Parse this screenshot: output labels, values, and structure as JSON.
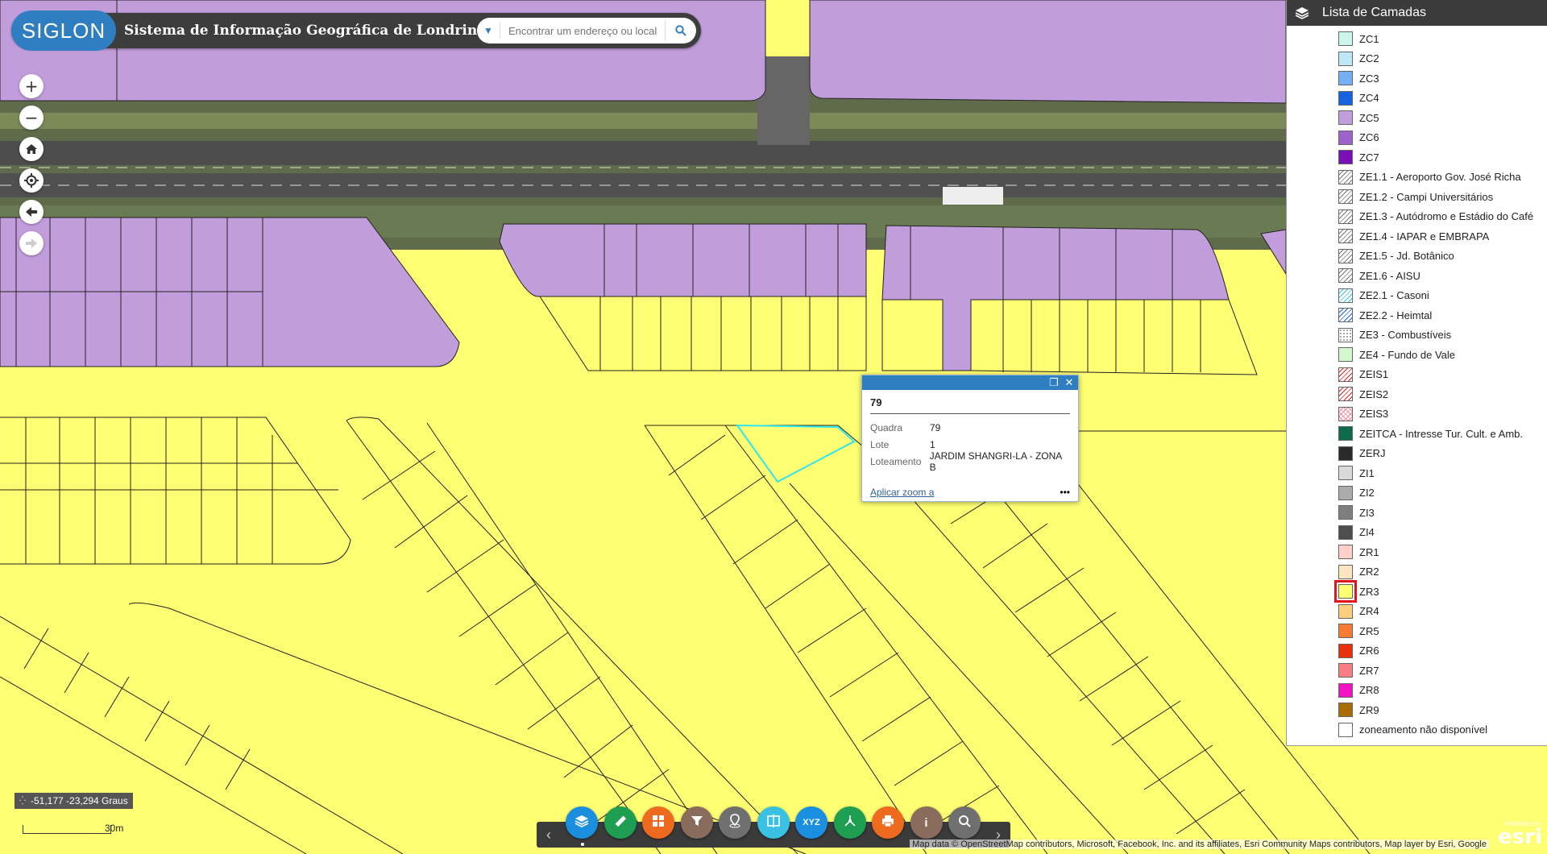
{
  "app": {
    "logo_text": "SIGLON",
    "title": "Sistema de Informação Geográfica de Londrina",
    "brand_color": "#2f7ec1"
  },
  "search": {
    "placeholder": "Encontrar um endereço ou local",
    "dropdown_icon": "caret-down-icon",
    "button_icon": "search-icon"
  },
  "nav_buttons": [
    {
      "name": "zoom-in",
      "glyph": "+"
    },
    {
      "name": "zoom-out",
      "glyph": "−"
    },
    {
      "name": "home",
      "glyph": "home-icon"
    },
    {
      "name": "locate",
      "glyph": "locate-icon"
    },
    {
      "name": "back",
      "glyph": "arrow-left-icon"
    },
    {
      "name": "forward",
      "glyph": "arrow-right-icon"
    }
  ],
  "layers_panel": {
    "title": "Lista de Camadas",
    "items": [
      {
        "label": "ZC1",
        "color": "#c9f5ea"
      },
      {
        "label": "ZC2",
        "color": "#bfe8f7"
      },
      {
        "label": "ZC3",
        "color": "#74b0f5"
      },
      {
        "label": "ZC4",
        "color": "#1663e0"
      },
      {
        "label": "ZC5",
        "color": "#c29ddb"
      },
      {
        "label": "ZC6",
        "color": "#9b63c9"
      },
      {
        "label": "ZC7",
        "color": "#7a0fb5"
      },
      {
        "label": "ZE1.1 - Aeroporto Gov. José Richa",
        "color": "hatch-gray"
      },
      {
        "label": "ZE1.2 - Campi Universitários",
        "color": "hatch-gray"
      },
      {
        "label": "ZE1.3 - Autódromo e Estádio do Café",
        "color": "hatch-gray"
      },
      {
        "label": "ZE1.4 - IAPAR e EMBRAPA",
        "color": "hatch-gray"
      },
      {
        "label": "ZE1.5 - Jd. Botânico",
        "color": "hatch-gray"
      },
      {
        "label": "ZE1.6 - AISU",
        "color": "hatch-gray"
      },
      {
        "label": "ZE2.1 - Casoni",
        "color": "hatch-cyan"
      },
      {
        "label": "ZE2.2 - Heimtal",
        "color": "hatch-blue"
      },
      {
        "label": "ZE3 - Combustíveis",
        "color": "dots-gray"
      },
      {
        "label": "ZE4 - Fundo de Vale",
        "color": "#d4f7cf"
      },
      {
        "label": "ZEIS1",
        "color": "hatch-red"
      },
      {
        "label": "ZEIS2",
        "color": "hatch-red"
      },
      {
        "label": "ZEIS3",
        "color": "cross-pink"
      },
      {
        "label": "ZEITCA - Intresse Tur. Cult. e Amb.",
        "color": "#0b6b4b"
      },
      {
        "label": "ZERJ",
        "color": "#2a2a2a"
      },
      {
        "label": "ZI1",
        "color": "#dadada"
      },
      {
        "label": "ZI2",
        "color": "#ababab"
      },
      {
        "label": "ZI3",
        "color": "#7e7e7e"
      },
      {
        "label": "ZI4",
        "color": "#4e4e4e"
      },
      {
        "label": "ZR1",
        "color": "#ffd0c8"
      },
      {
        "label": "ZR2",
        "color": "#fbe6c0"
      },
      {
        "label": "ZR3",
        "color": "#ffff73",
        "highlighted": true
      },
      {
        "label": "ZR4",
        "color": "#fbcf7d"
      },
      {
        "label": "ZR5",
        "color": "#f57c35"
      },
      {
        "label": "ZR6",
        "color": "#e8300f"
      },
      {
        "label": "ZR7",
        "color": "#f57f84"
      },
      {
        "label": "ZR8",
        "color": "#f214c4"
      },
      {
        "label": "ZR9",
        "color": "#a86b05"
      },
      {
        "label": "zoneamento não disponível",
        "color": "#ffffff"
      }
    ]
  },
  "popup": {
    "title": "79",
    "rows": [
      {
        "key": "Quadra",
        "value": "79"
      },
      {
        "key": "Lote",
        "value": "1"
      },
      {
        "key": "Loteamento",
        "value": "JARDIM SHANGRI-LA - ZONA B"
      }
    ],
    "zoom_link": "Aplicar zoom a",
    "more": "•••"
  },
  "coordinates": "-51,177 -23,294 Graus",
  "scale_label": "30m",
  "toolbar": {
    "tools": [
      {
        "name": "layers",
        "color": "#1a8fe0",
        "glyph": "layers-icon"
      },
      {
        "name": "measure",
        "color": "#1e9e50",
        "glyph": "ruler-icon"
      },
      {
        "name": "basemap",
        "color": "#ee6a1f",
        "glyph": "grid-icon"
      },
      {
        "name": "filter",
        "color": "#8a6c5c",
        "glyph": "filter-icon"
      },
      {
        "name": "geolocate",
        "color": "#6f6f6f",
        "glyph": "pin-icon"
      },
      {
        "name": "swipe",
        "color": "#3ac0e3",
        "glyph": "swipe-icon"
      },
      {
        "name": "xyz",
        "color": "#1a8fe0",
        "glyph": "XYZ"
      },
      {
        "name": "share",
        "color": "#1e9e50",
        "glyph": "share-icon"
      },
      {
        "name": "print",
        "color": "#ee6a1f",
        "glyph": "print-icon"
      },
      {
        "name": "info",
        "color": "#8a6c5c",
        "glyph": "i"
      },
      {
        "name": "query",
        "color": "#6f6f6f",
        "glyph": "magnify-icon"
      }
    ]
  },
  "attribution": "Map data © OpenStreetMap contributors, Microsoft, Facebook, Inc. and its affiliates, Esri Community Maps contributors, Map layer by Esri, Google",
  "esri": {
    "powered": "POWERED BY",
    "name": "esri"
  }
}
